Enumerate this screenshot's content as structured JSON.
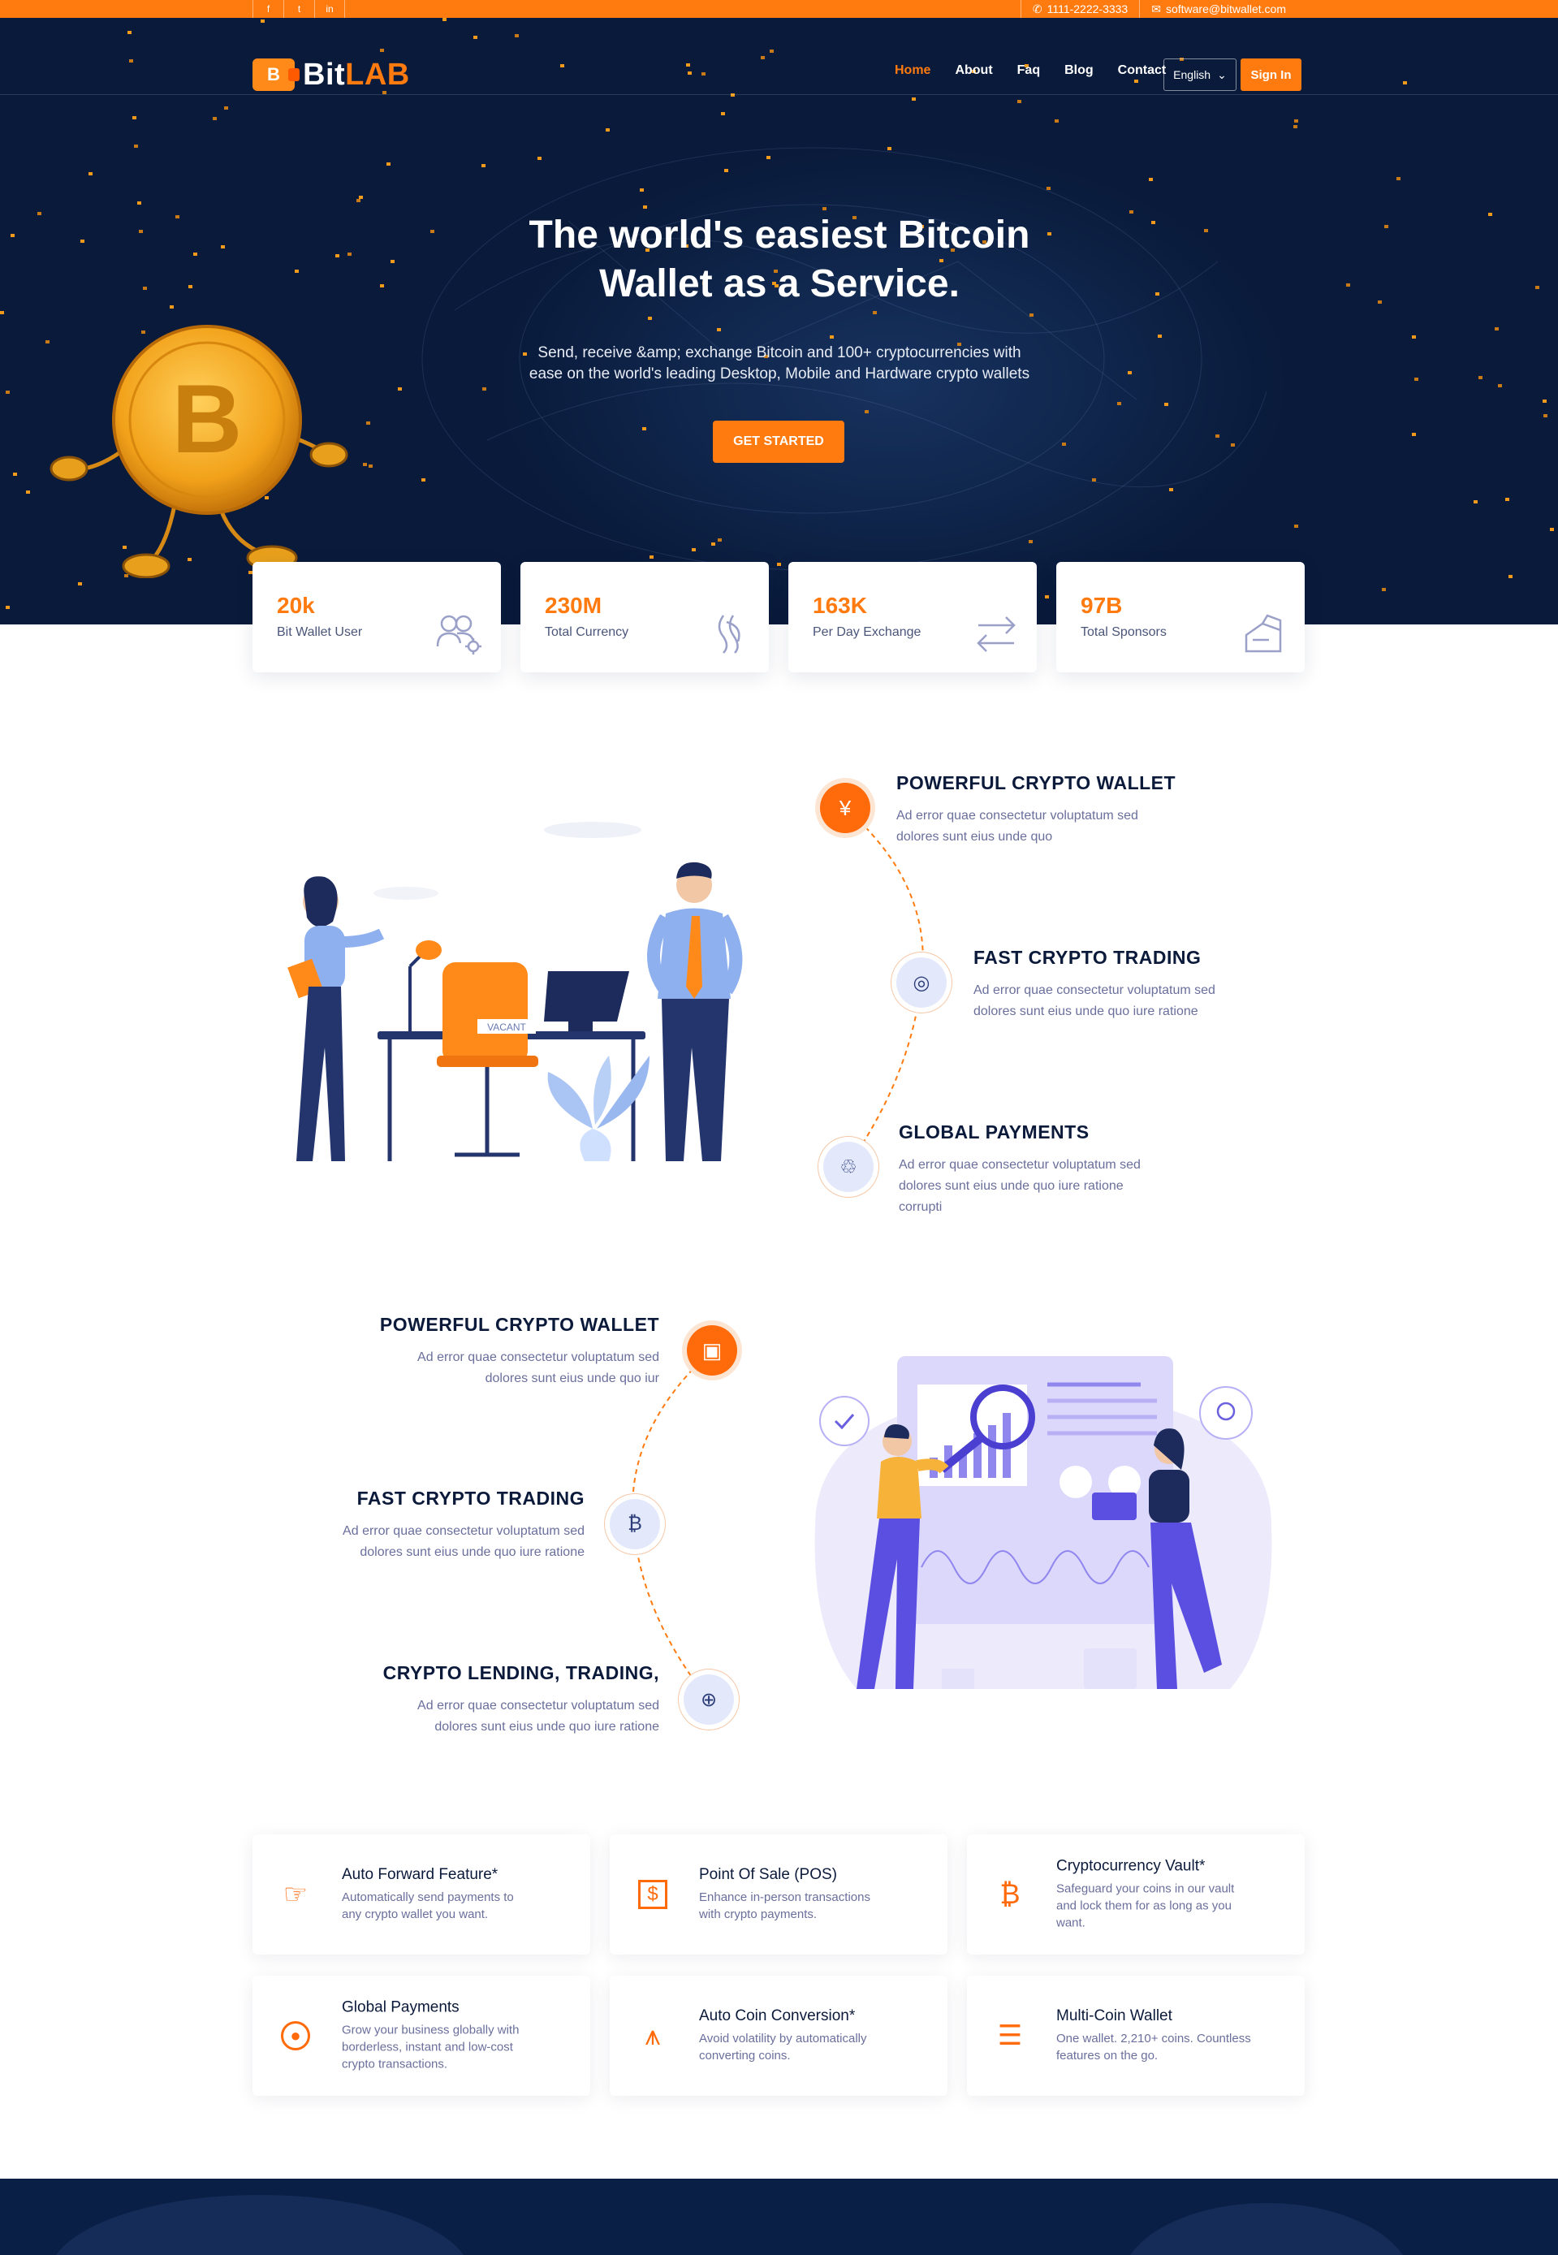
{
  "topbar": {
    "social_icons": [
      "facebook-icon",
      "twitter-icon",
      "linkedin-icon"
    ],
    "phone": "1111-2222-3333",
    "email": "software@bitwallet.com"
  },
  "brand": {
    "logo_part1": "Bit",
    "logo_part2": "LAB",
    "mark_letter": "B"
  },
  "nav": {
    "items": [
      "Home",
      "About",
      "Faq",
      "Blog",
      "Contact"
    ],
    "active": "Home",
    "language": "English",
    "signin": "Sign In"
  },
  "hero": {
    "title_line1": "The world's easiest Bitcoin",
    "title_line2": "Wallet as a Service.",
    "subtitle_line1": "Send, receive &amp; exchange Bitcoin and 100+ cryptocurrencies with",
    "subtitle_line2": "ease on the world's leading Desktop, Mobile and Hardware crypto wallets",
    "cta": "GET STARTED"
  },
  "stats": [
    {
      "value": "20k",
      "label": "Bit Wallet User",
      "icon": "users-gear-icon"
    },
    {
      "value": "230M",
      "label": "Total Currency",
      "icon": "currency-icon"
    },
    {
      "value": "163K",
      "label": "Per Day Exchange",
      "icon": "exchange-arrows-icon"
    },
    {
      "value": "97B",
      "label": "Total Sponsors",
      "icon": "sponsor-hand-icon"
    }
  ],
  "features_a": [
    {
      "title": "POWERFUL CRYPTO WALLET",
      "line1": "Ad error quae consectetur voluptatum sed",
      "line2": "dolores sunt eius unde quo",
      "line3": "",
      "icon": "yen-coin-icon"
    },
    {
      "title": "FAST CRYPTO TRADING",
      "line1": "Ad error quae consectetur voluptatum sed",
      "line2": "dolores sunt eius unde quo iure ratione",
      "line3": "",
      "icon": "coin-stack-icon"
    },
    {
      "title": "GLOBAL PAYMENTS",
      "line1": "Ad error quae consectetur voluptatum sed",
      "line2": "dolores sunt eius unde quo iure ratione",
      "line3": "corrupti",
      "icon": "recycle-icon"
    }
  ],
  "illustration_a": {
    "chair_sign": "VACANT"
  },
  "features_b": [
    {
      "title": "POWERFUL CRYPTO WALLET",
      "line1": "Ad error quae consectetur voluptatum sed",
      "line2": "dolores sunt eius unde quo iur",
      "icon": "wallet-icon"
    },
    {
      "title": "FAST CRYPTO TRADING",
      "line1": "Ad error quae consectetur voluptatum sed",
      "line2": "dolores sunt eius unde quo iure ratione",
      "icon": "bitcoin-icon"
    },
    {
      "title": "CRYPTO LENDING, TRADING,",
      "line1": "Ad error quae consectetur voluptatum sed",
      "line2": "dolores sunt eius unde quo iure ratione",
      "icon": "globe-coin-icon"
    }
  ],
  "cards": [
    {
      "title": "Auto Forward Feature*",
      "line1": "Automatically send payments to",
      "line2": "any crypto wallet you want.",
      "line3": "",
      "icon": "pointing-hand-icon"
    },
    {
      "title": "Point Of Sale (POS)",
      "line1": "Enhance in-person transactions",
      "line2": "with crypto payments.",
      "line3": "",
      "icon": "pos-dollar-icon"
    },
    {
      "title": "Cryptocurrency Vault*",
      "line1": "Safeguard your coins in our vault",
      "line2": "and lock them for as long as you",
      "line3": "want.",
      "icon": "bitcoin-icon"
    },
    {
      "title": "Global Payments",
      "line1": "Grow your business globally with",
      "line2": "borderless, instant and low-cost",
      "line3": "crypto transactions.",
      "icon": "globe-icon"
    },
    {
      "title": "Auto Coin Conversion*",
      "line1": "Avoid volatility by automatically",
      "line2": "converting coins.",
      "line3": "",
      "icon": "conversion-icon"
    },
    {
      "title": "Multi-Coin Wallet",
      "line1": "One wallet. 2,210+ coins. Countless",
      "line2": "features on the go.",
      "line3": "",
      "icon": "coins-stack-icon"
    }
  ],
  "colors": {
    "accent": "#ff7a0f",
    "navy": "#091a3a",
    "text_muted": "#6a6f9c"
  }
}
